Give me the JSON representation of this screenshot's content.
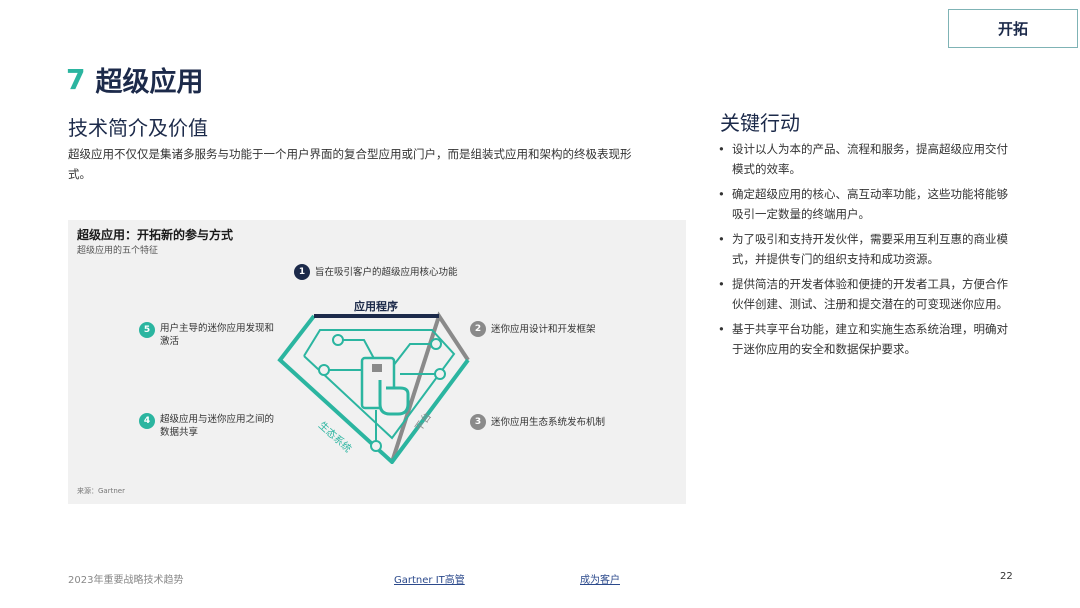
{
  "tag": "开拓",
  "section": {
    "number": "7",
    "title": "超级应用"
  },
  "left": {
    "heading": "技术简介及价值",
    "intro": "超级应用不仅仅是集诸多服务与功能于一个用户界面的复合型应用或门户，而是组装式应用和架构的终极表现形式。"
  },
  "figure": {
    "title": "超级应用：开拓新的参与方式",
    "subtitle": "超级应用的五个特征",
    "source": "来源：Gartner",
    "diagram_labels": {
      "top": "应用程序",
      "left_edge": "生态系统",
      "right_edge": "平台"
    },
    "features": [
      {
        "num": "1",
        "text": "旨在吸引客户的超级应用核心功能"
      },
      {
        "num": "2",
        "text": "迷你应用设计和开发框架"
      },
      {
        "num": "3",
        "text": "迷你应用生态系统发布机制"
      },
      {
        "num": "4",
        "text": "超级应用与迷你应用之间的数据共享"
      },
      {
        "num": "5",
        "text": "用户主导的迷你应用发现和激活"
      }
    ]
  },
  "right": {
    "heading": "关键行动",
    "actions": [
      "设计以人为本的产品、流程和服务，提高超级应用交付模式的效率。",
      "确定超级应用的核心、高互动率功能，这些功能将能够吸引一定数量的终端用户。",
      "为了吸引和支持开发伙伴，需要采用互利互惠的商业模式，并提供专门的组织支持和成功资源。",
      "提供简洁的开发者体验和便捷的开发者工具，方便合作伙伴创建、测试、注册和提交潜在的可变现迷你应用。",
      "基于共享平台功能，建立和实施生态系统治理，明确对于迷你应用的安全和数据保护要求。"
    ]
  },
  "footer": {
    "left": "2023年重要战略技术趋势",
    "link1": "Gartner IT高管",
    "link2": "成为客户",
    "page": "22"
  },
  "colors": {
    "navy": "#1c2a4a",
    "teal": "#2bb5a0",
    "gray": "#8a8a8a"
  }
}
